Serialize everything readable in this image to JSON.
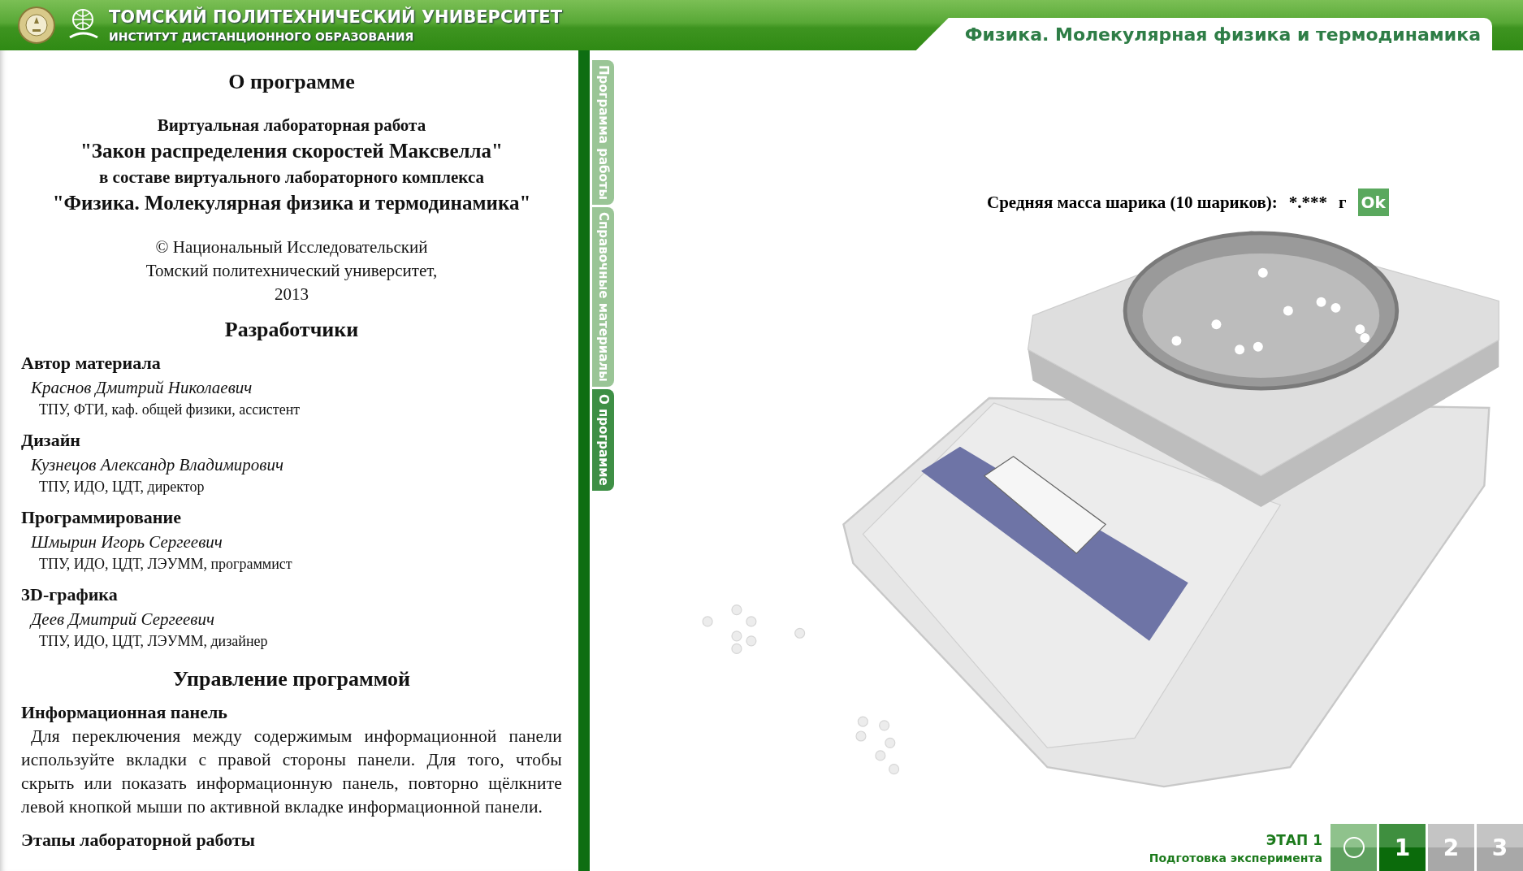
{
  "header": {
    "university": "ТОМСКИЙ ПОЛИТЕХНИЧЕСКИЙ УНИВЕРСИТЕТ",
    "institute": "ИНСТИТУТ ДИСТАНЦИОННОГО ОБРАЗОВАНИЯ",
    "course": "Физика. Молекулярная физика и термодинамика"
  },
  "info_panel": {
    "title": "О программе",
    "intro": [
      "Виртуальная лабораторная работа",
      "\"Закон распределения скоростей Максвелла\"",
      "в составе виртуального лабораторного комплекса",
      "\"Физика. Молекулярная физика и термодинамика\""
    ],
    "copyright": [
      "© Национальный Исследовательский",
      "Томский политехнический университет,",
      "2013"
    ],
    "developers_title": "Разработчики",
    "developers": [
      {
        "role": "Автор материала",
        "name": "Краснов Дмитрий Николаевич",
        "affiliation": "ТПУ, ФТИ, каф. общей физики, ассистент"
      },
      {
        "role": "Дизайн",
        "name": "Кузнецов Александр Владимирович",
        "affiliation": "ТПУ, ИДО, ЦДТ, директор"
      },
      {
        "role": "Программирование",
        "name": "Шмырин Игорь Сергеевич",
        "affiliation": "ТПУ, ИДО, ЦДТ, ЛЭУММ, программист"
      },
      {
        "role": "3D-графика",
        "name": "Деев Дмитрий Сергеевич",
        "affiliation": "ТПУ, ИДО, ЦДТ, ЛЭУММ, дизайнер"
      }
    ],
    "controls_title": "Управление программой",
    "sections": [
      {
        "heading": "Информационная панель",
        "text": "Для переключения между содержимым информационной панели используйте вкладки с правой стороны панели. Для того, чтобы скрыть или показать информационную панель, повторно щёлкните левой кнопкой мыши по активной вкладке информационной панели."
      },
      {
        "heading": "Этапы лабораторной работы"
      }
    ]
  },
  "side_tabs": [
    {
      "label": "Программа работы",
      "selected": false
    },
    {
      "label": "Справочные материалы",
      "selected": false
    },
    {
      "label": "О программе",
      "selected": true
    }
  ],
  "experiment": {
    "mass_label": "Средняя масса шарика (10 шариков):",
    "mass_value": "*.***",
    "unit": "г",
    "ok_button": "Ok"
  },
  "stage": {
    "title": "ЭТАП 1",
    "subtitle": "Подготовка эксперимента"
  },
  "stage_buttons": [
    {
      "kind": "circle",
      "selected": false,
      "disabled": false
    },
    {
      "kind": "number",
      "label": "1",
      "selected": true,
      "disabled": false
    },
    {
      "kind": "number",
      "label": "2",
      "selected": false,
      "disabled": true
    },
    {
      "kind": "number",
      "label": "3",
      "selected": false,
      "disabled": true
    }
  ]
}
